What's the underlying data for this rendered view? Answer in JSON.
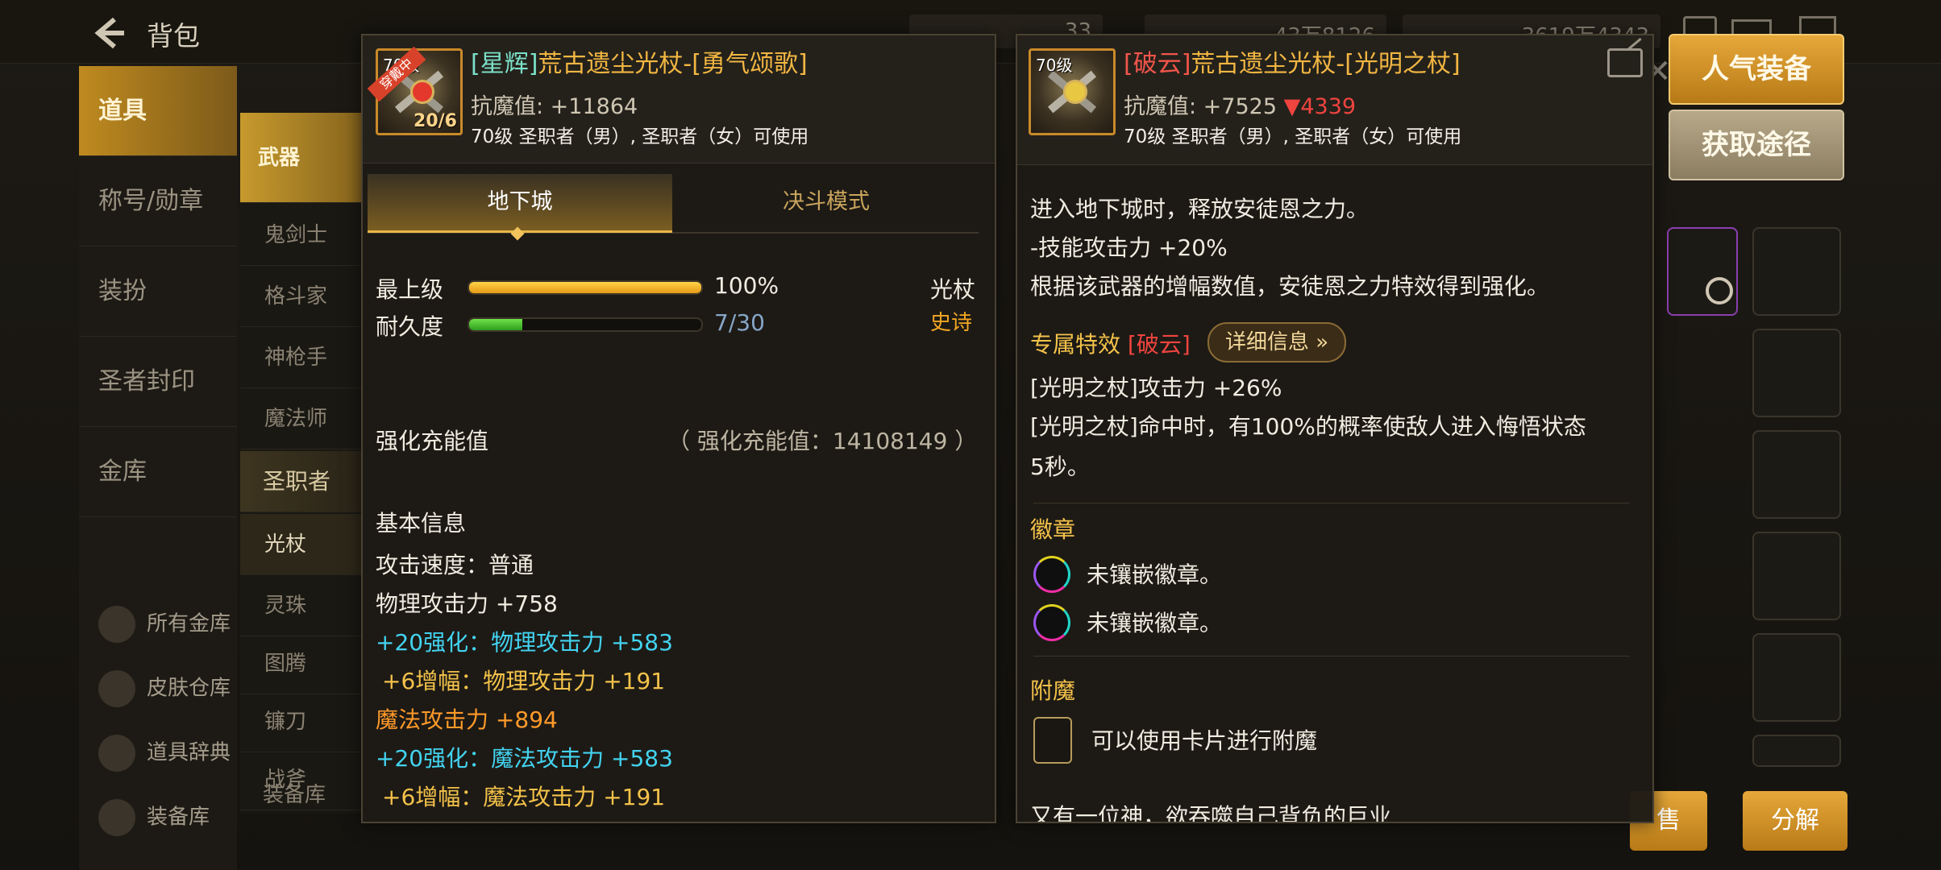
{
  "topbar": {
    "back_label": "背包",
    "res1": "33",
    "res2": "43万8126",
    "res3": "3619万4343"
  },
  "left_nav": {
    "items": [
      "道具",
      "称号/勋章",
      "装扮",
      "圣者封印",
      "金库"
    ],
    "bottom_links": [
      "所有金库",
      "皮肤仓库",
      "道具辞典",
      "装备库"
    ]
  },
  "sub_nav": {
    "category_weapon": "武器",
    "classes": [
      "鬼剑士",
      "格斗家",
      "神枪手",
      "魔法师"
    ],
    "category_priest": "圣职者",
    "priest_types": [
      "光杖",
      "灵珠",
      "图腾",
      "镰刀",
      "战斧"
    ],
    "bottom_partial": "装备库"
  },
  "buttons": {
    "popular": "人气装备",
    "source": "获取途径",
    "sell": "售",
    "dismantle": "分解"
  },
  "left_panel": {
    "icon_level": "70级",
    "icon_ribbon": "穿戴中",
    "icon_count": "20/6",
    "title_prefix": "[星辉]",
    "title_main": "荒古遗尘光杖-[勇气颂歌]",
    "magic_resist": "抗魔值: +11864",
    "usable": "70级 圣职者（男）, 圣职者（女）可使用",
    "tab_dungeon": "地下城",
    "tab_duel": "决斗模式",
    "grade_label": "最上级",
    "grade_value": "100%",
    "grade_pct": 100,
    "durability_label": "耐久度",
    "durability_value": "7/30",
    "durability_pct": 23,
    "weapon_type": "光杖",
    "rarity": "史诗",
    "charge_label": "强化充能值",
    "charge_value": "（ 强化充能值：14108149 ）",
    "basic_info": "基本信息",
    "attack_speed": "攻击速度：普通",
    "phys_atk_label": "物理攻击力",
    "phys_atk_val": "+758",
    "enh_phys_a": "+20",
    "enh_phys_b": "强化：",
    "enh_phys_c": "物理攻击力",
    "enh_phys_d": "+583",
    "amp_phys_a": "+6",
    "amp_phys_b": "增幅：",
    "amp_phys_c": "物理攻击力",
    "amp_phys_d": "+191",
    "mag_atk_label": "魔法攻击力",
    "mag_atk_val": "+894",
    "enh_mag_a": "+20",
    "enh_mag_b": "强化：",
    "enh_mag_c": "魔法攻击力",
    "enh_mag_d": "+583",
    "amp_mag_a": "+6",
    "amp_mag_b": "增幅：",
    "amp_mag_c": "魔法攻击力",
    "amp_mag_d": "+191"
  },
  "right_panel": {
    "icon_level": "70级",
    "title_prefix": "[破云]",
    "title_main": "荒古遗尘光杖-[光明之杖]",
    "magic_resist": "抗魔值: +7525",
    "magic_resist_diff": "▼4339",
    "usable": "70级 圣职者（男）, 圣职者（女）可使用",
    "effect_line1": "进入地下城时，释放安徒恩之力。",
    "effect_line2": "-技能攻击力 +20%",
    "effect_line3": "根据该武器的增幅数值，安徒恩之力特效得到强化。",
    "exclusive_label": "专属特效",
    "exclusive_tag": "[破云]",
    "detail_button": "详细信息",
    "exclusive_line1": "[光明之杖]攻击力 +26%",
    "exclusive_line2": "[光明之杖]命中时，有100%的概率使敌人进入悔悟状态",
    "exclusive_line3": "5秒。",
    "badge_label": "徽章",
    "badge_slot1": "未镶嵌徽章。",
    "badge_slot2": "未镶嵌徽章。",
    "enchant_label": "附魔",
    "enchant_text": "可以使用卡片进行附魔",
    "flavor_partial": "又有一位神，欲吞噬自己背负的巨业"
  },
  "colors": {
    "gold": "#f4c24a",
    "blue": "#43d3f0",
    "orange": "#ff9a2a",
    "red": "#f0443f",
    "teal": "#7ce0c8"
  }
}
